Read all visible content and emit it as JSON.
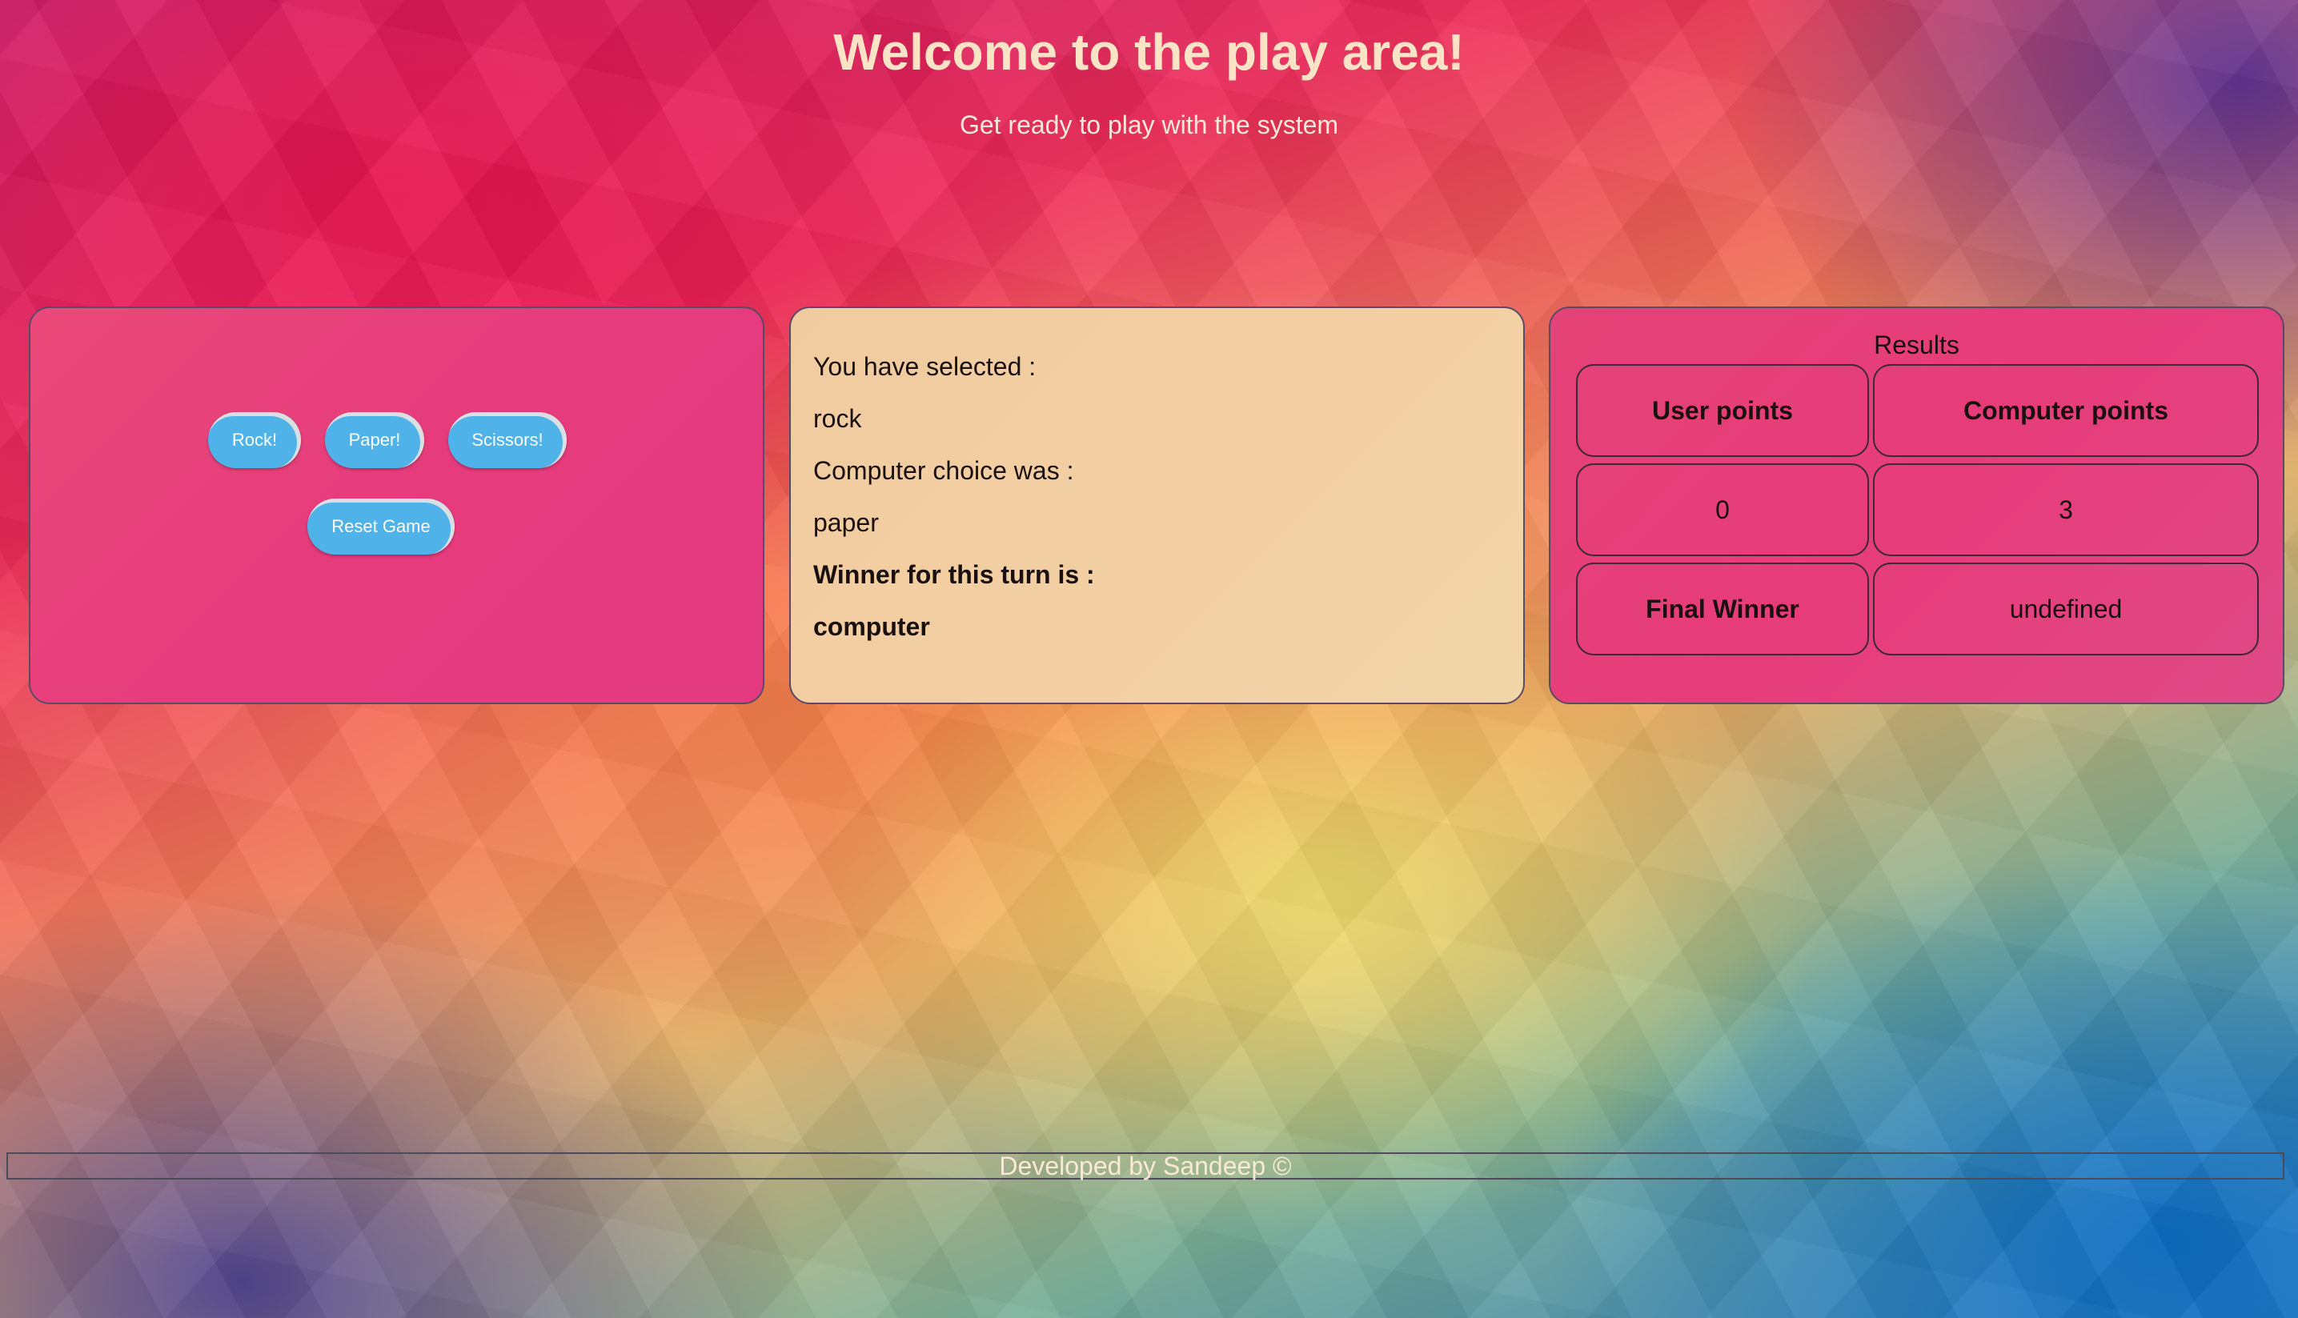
{
  "header": {
    "title": "Welcome to the play area!",
    "subtitle": "Get ready to play with the system"
  },
  "controls": {
    "rock_label": "Rock!",
    "paper_label": "Paper!",
    "scissors_label": "Scissors!",
    "reset_label": "Reset Game"
  },
  "status": {
    "selected_caption": "You have selected :",
    "selected_value": "rock",
    "computer_caption": "Computer choice was :",
    "computer_value": "paper",
    "winner_caption": "Winner for this turn is :",
    "winner_value": "computer"
  },
  "results": {
    "caption": "Results",
    "user_points_header": "User points",
    "computer_points_header": "Computer points",
    "user_points": "0",
    "computer_points": "3",
    "final_winner_header": "Final Winner",
    "final_winner_value": "undefined"
  },
  "footer": {
    "text": "Developed by Sandeep ©"
  },
  "colors": {
    "button": "#4fb3ea",
    "panel_pink": "#e63b7c",
    "panel_peach": "#f2d0a4",
    "title_text": "#fbe3c6"
  }
}
